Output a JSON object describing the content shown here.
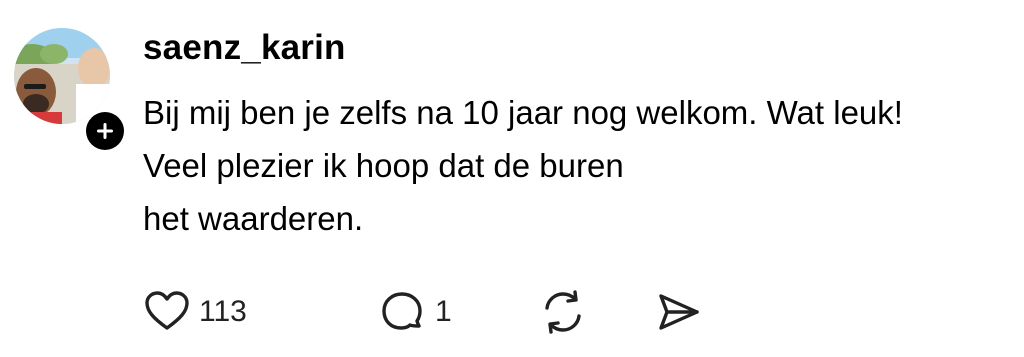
{
  "post": {
    "username": "saenz_karin",
    "lines": [
      "Bij mij ben je zelfs na 10 jaar nog welkom. Wat leuk!",
      "Veel plezier ik hoop dat de buren",
      "het waarderen."
    ],
    "like_count": "113",
    "reply_count": "1"
  },
  "icons": {
    "avatar": "profile-photo",
    "follow": "plus-icon",
    "like": "heart-icon",
    "reply": "speech-bubble-icon",
    "repost": "repost-icon",
    "share": "send-icon"
  },
  "colors": {
    "text": "#000000",
    "background": "#ffffff",
    "icon": "#222222"
  }
}
